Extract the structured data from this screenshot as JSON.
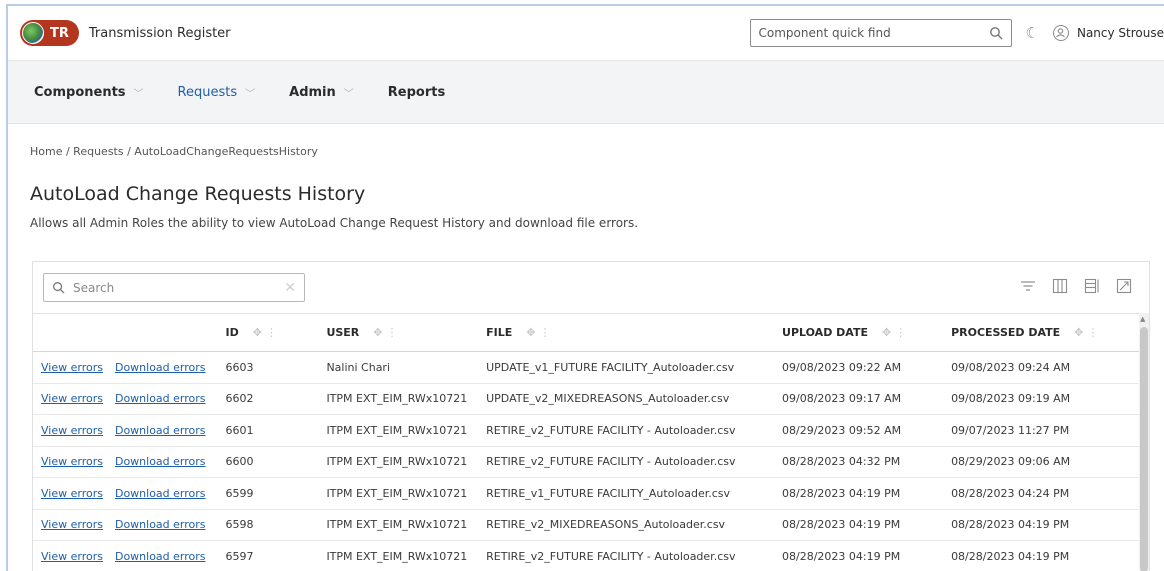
{
  "header": {
    "logo_text": "TR",
    "app_title": "Transmission Register",
    "quick_find_placeholder": "Component quick find",
    "user_name": "Nancy Strouse"
  },
  "nav": [
    {
      "label": "Components",
      "has_menu": true,
      "active": false
    },
    {
      "label": "Requests",
      "has_menu": true,
      "active": true
    },
    {
      "label": "Admin",
      "has_menu": true,
      "active": false
    },
    {
      "label": "Reports",
      "has_menu": false,
      "active": false
    }
  ],
  "breadcrumb": "Home / Requests / AutoLoadChangeRequestsHistory",
  "page": {
    "title": "AutoLoad Change Requests History",
    "description": "Allows all Admin Roles the ability to view AutoLoad Change Request History and download file errors."
  },
  "table": {
    "search_placeholder": "Search",
    "columns": [
      "ID",
      "USER",
      "FILE",
      "UPLOAD DATE",
      "PROCESSED DATE"
    ],
    "action_labels": {
      "view": "View errors",
      "download": "Download errors"
    },
    "rows": [
      {
        "id": "6603",
        "user": "Nalini Chari",
        "file": "UPDATE_v1_FUTURE FACILITY_Autoloader.csv",
        "upload": "09/08/2023 09:22 AM",
        "processed": "09/08/2023 09:24 AM"
      },
      {
        "id": "6602",
        "user": "ITPM EXT_EIM_RWx10721",
        "file": "UPDATE_v2_MIXEDREASONS_Autoloader.csv",
        "upload": "09/08/2023 09:17 AM",
        "processed": "09/08/2023 09:19 AM"
      },
      {
        "id": "6601",
        "user": "ITPM EXT_EIM_RWx10721",
        "file": "RETIRE_v2_FUTURE FACILITY - Autoloader.csv",
        "upload": "08/29/2023 09:52 AM",
        "processed": "09/07/2023 11:27 PM"
      },
      {
        "id": "6600",
        "user": "ITPM EXT_EIM_RWx10721",
        "file": "RETIRE_v2_FUTURE FACILITY - Autoloader.csv",
        "upload": "08/28/2023 04:32 PM",
        "processed": "08/29/2023 09:06 AM"
      },
      {
        "id": "6599",
        "user": "ITPM EXT_EIM_RWx10721",
        "file": "RETIRE_v1_FUTURE FACILITY_Autoloader.csv",
        "upload": "08/28/2023 04:19 PM",
        "processed": "08/28/2023 04:24 PM"
      },
      {
        "id": "6598",
        "user": "ITPM EXT_EIM_RWx10721",
        "file": "RETIRE_v2_MIXEDREASONS_Autoloader.csv",
        "upload": "08/28/2023 04:19 PM",
        "processed": "08/28/2023 04:19 PM"
      },
      {
        "id": "6597",
        "user": "ITPM EXT_EIM_RWx10721",
        "file": "RETIRE_v2_FUTURE FACILITY - Autoloader.csv",
        "upload": "08/28/2023 04:19 PM",
        "processed": "08/28/2023 04:19 PM"
      }
    ]
  },
  "colors": {
    "link": "#1f5fa8",
    "logo_bg": "#b5361e",
    "nav_bg": "#f3f4f5"
  }
}
